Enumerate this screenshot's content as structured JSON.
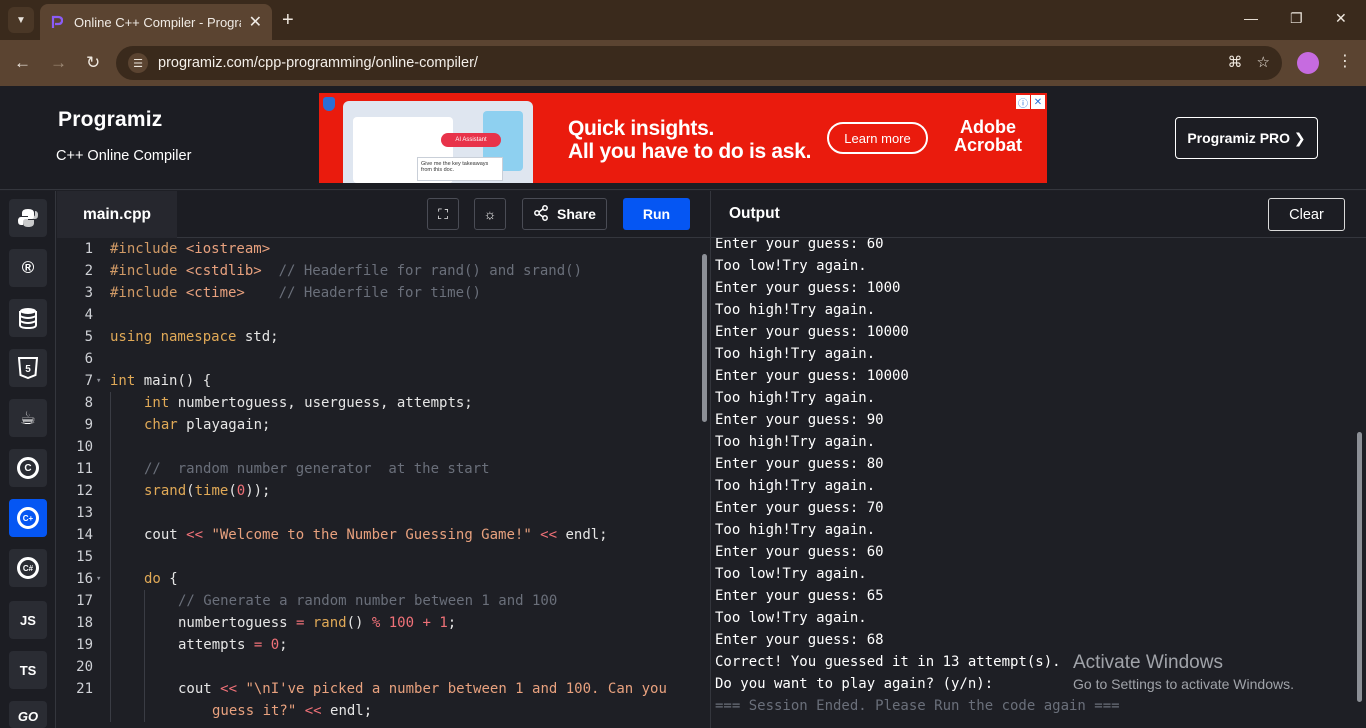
{
  "browser": {
    "tab_title": "Online C++ Compiler - Programiz",
    "url": "programiz.com/cpp-programming/online-compiler/"
  },
  "header": {
    "logo": "Programiz",
    "subtitle": "C++ Online Compiler",
    "pro_button": "Programiz PRO ❯"
  },
  "ad": {
    "headline_1": "Quick insights.",
    "headline_2": "All you have to do is ask.",
    "cta": "Learn more",
    "brand_1": "Adobe",
    "brand_2": "Acrobat",
    "pill": "AI Assistant",
    "bubble": "Give me the key takeaways from this doc."
  },
  "languages": [
    "python",
    "r",
    "sql",
    "html",
    "java",
    "c",
    "cpp",
    "csharp",
    "js",
    "ts",
    "go"
  ],
  "language_labels": {
    "js": "JS",
    "ts": "TS",
    "go": "GO"
  },
  "editor": {
    "file_tab": "main.cpp",
    "share_label": "Share",
    "run_label": "Run"
  },
  "code_lines": [
    {
      "n": "1",
      "fold": false,
      "indent": 0,
      "parts": [
        [
          "inc",
          "#include "
        ],
        [
          "str",
          "<iostream>"
        ]
      ]
    },
    {
      "n": "2",
      "fold": false,
      "indent": 0,
      "parts": [
        [
          "inc",
          "#include "
        ],
        [
          "str",
          "<cstdlib>"
        ],
        [
          "cmt",
          "  // Headerfile for rand() and srand()"
        ]
      ]
    },
    {
      "n": "3",
      "fold": false,
      "indent": 0,
      "parts": [
        [
          "inc",
          "#include "
        ],
        [
          "str",
          "<ctime>"
        ],
        [
          "cmt",
          "    // Headerfile for time()"
        ]
      ]
    },
    {
      "n": "4",
      "fold": false,
      "indent": 0,
      "parts": []
    },
    {
      "n": "5",
      "fold": false,
      "indent": 0,
      "parts": [
        [
          "kw",
          "using namespace "
        ],
        [
          "plain",
          "std;"
        ]
      ]
    },
    {
      "n": "6",
      "fold": false,
      "indent": 0,
      "parts": []
    },
    {
      "n": "7",
      "fold": true,
      "indent": 0,
      "parts": [
        [
          "kw",
          "int "
        ],
        [
          "plain",
          "main() {"
        ]
      ]
    },
    {
      "n": "8",
      "fold": false,
      "indent": 1,
      "parts": [
        [
          "kw",
          "int "
        ],
        [
          "plain",
          "numbertoguess, userguess, attempts;"
        ]
      ]
    },
    {
      "n": "9",
      "fold": false,
      "indent": 1,
      "parts": [
        [
          "kw",
          "char "
        ],
        [
          "plain",
          "playagain;"
        ]
      ]
    },
    {
      "n": "10",
      "fold": false,
      "indent": 0,
      "parts": []
    },
    {
      "n": "11",
      "fold": false,
      "indent": 1,
      "parts": [
        [
          "cmt",
          "//  random number generator  at the start"
        ]
      ]
    },
    {
      "n": "12",
      "fold": false,
      "indent": 1,
      "parts": [
        [
          "kw",
          "srand"
        ],
        [
          "plain",
          "("
        ],
        [
          "kw",
          "time"
        ],
        [
          "plain",
          "("
        ],
        [
          "num",
          "0"
        ],
        [
          "plain",
          "));"
        ]
      ]
    },
    {
      "n": "13",
      "fold": false,
      "indent": 0,
      "parts": []
    },
    {
      "n": "14",
      "fold": false,
      "indent": 1,
      "parts": [
        [
          "plain",
          "cout "
        ],
        [
          "num",
          "<< "
        ],
        [
          "str",
          "\"Welcome to the Number Guessing Game!\""
        ],
        [
          "num",
          " << "
        ],
        [
          "plain",
          "endl;"
        ]
      ]
    },
    {
      "n": "15",
      "fold": false,
      "indent": 0,
      "parts": []
    },
    {
      "n": "16",
      "fold": true,
      "indent": 1,
      "parts": [
        [
          "kw",
          "do "
        ],
        [
          "plain",
          "{"
        ]
      ]
    },
    {
      "n": "17",
      "fold": false,
      "indent": 2,
      "parts": [
        [
          "cmt",
          "// Generate a random number between 1 and 100"
        ]
      ]
    },
    {
      "n": "18",
      "fold": false,
      "indent": 2,
      "parts": [
        [
          "plain",
          "numbertoguess "
        ],
        [
          "num",
          "= "
        ],
        [
          "kw",
          "rand"
        ],
        [
          "plain",
          "() "
        ],
        [
          "num",
          "% 100 + 1"
        ],
        [
          "plain",
          ";"
        ]
      ]
    },
    {
      "n": "19",
      "fold": false,
      "indent": 2,
      "parts": [
        [
          "plain",
          "attempts "
        ],
        [
          "num",
          "= 0"
        ],
        [
          "plain",
          ";"
        ]
      ]
    },
    {
      "n": "20",
      "fold": false,
      "indent": 0,
      "parts": []
    },
    {
      "n": "21",
      "fold": false,
      "indent": 2,
      "parts": [
        [
          "plain",
          "cout "
        ],
        [
          "num",
          "<< "
        ],
        [
          "str",
          "\"\\nI've picked a number between 1 and 100. Can you"
        ]
      ]
    },
    {
      "n": "",
      "fold": false,
      "indent": 3,
      "parts": [
        [
          "str",
          "guess it?\""
        ],
        [
          "num",
          " << "
        ],
        [
          "plain",
          "endl;"
        ]
      ]
    }
  ],
  "output": {
    "title": "Output",
    "clear_label": "Clear",
    "lines": [
      "Enter your guess: 60",
      "Too low!Try again.",
      "Enter your guess: 1000",
      "Too high!Try again.",
      "Enter your guess: 10000",
      "Too high!Try again.",
      "Enter your guess: 10000",
      "Too high!Try again.",
      "Enter your guess: 90",
      "Too high!Try again.",
      "Enter your guess: 80",
      "Too high!Try again.",
      "Enter your guess: 70",
      "Too high!Try again.",
      "Enter your guess: 60",
      "Too low!Try again.",
      "Enter your guess: 65",
      "Too low!Try again.",
      "Enter your guess: 68",
      "Correct! You guessed it in 13 attempt(s).",
      "Do you want to play again? (y/n):"
    ],
    "session_end": "=== Session Ended. Please Run the code again ==="
  },
  "watermark": {
    "line1": "Activate Windows",
    "line2": "Go to Settings to activate Windows."
  },
  "colors": {
    "run_blue": "#0556f3",
    "ad_red": "#ea1b0d",
    "keyword": "#e0a957",
    "string": "#e8a17e",
    "comment": "#6a6f7a"
  }
}
